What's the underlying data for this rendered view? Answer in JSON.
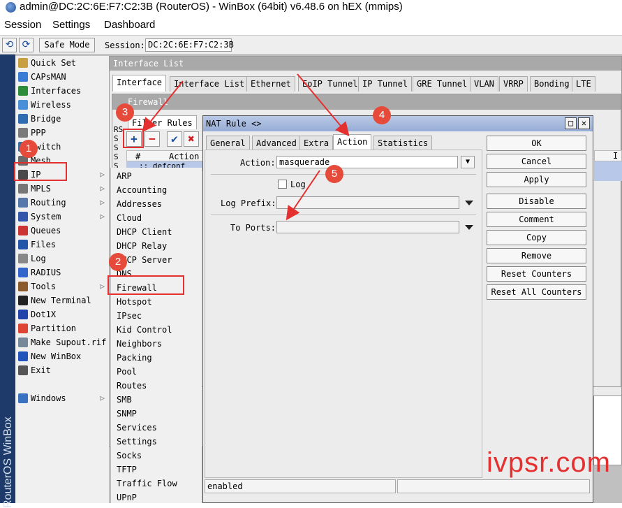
{
  "window": {
    "title": "admin@DC:2C:6E:F7:C2:3B (RouterOS) - WinBox (64bit) v6.48.6 on hEX (mmips)"
  },
  "menubar": [
    "Session",
    "Settings",
    "Dashboard"
  ],
  "toolbar": {
    "safe_mode_label": "Safe Mode",
    "session_label": "Session:",
    "session_value": "DC:2C:6E:F7:C2:3B"
  },
  "vertical_brand": "RouterOS WinBox",
  "sidebar": {
    "items": [
      {
        "label": "Quick Set",
        "icon": "quick-set-icon"
      },
      {
        "label": "CAPsMAN",
        "icon": "capsman-icon"
      },
      {
        "label": "Interfaces",
        "icon": "interfaces-icon"
      },
      {
        "label": "Wireless",
        "icon": "wireless-icon"
      },
      {
        "label": "Bridge",
        "icon": "bridge-icon"
      },
      {
        "label": "PPP",
        "icon": "ppp-icon"
      },
      {
        "label": "Switch",
        "icon": "switch-icon"
      },
      {
        "label": "Mesh",
        "icon": "mesh-icon"
      },
      {
        "label": "IP",
        "icon": "ip-icon",
        "submenu": true
      },
      {
        "label": "MPLS",
        "icon": "mpls-icon",
        "submenu": true
      },
      {
        "label": "Routing",
        "icon": "routing-icon",
        "submenu": true
      },
      {
        "label": "System",
        "icon": "system-icon",
        "submenu": true
      },
      {
        "label": "Queues",
        "icon": "queues-icon"
      },
      {
        "label": "Files",
        "icon": "files-icon"
      },
      {
        "label": "Log",
        "icon": "log-icon"
      },
      {
        "label": "RADIUS",
        "icon": "radius-icon"
      },
      {
        "label": "Tools",
        "icon": "tools-icon",
        "submenu": true
      },
      {
        "label": "New Terminal",
        "icon": "terminal-icon"
      },
      {
        "label": "Dot1X",
        "icon": "dot1x-icon"
      },
      {
        "label": "Partition",
        "icon": "partition-icon"
      },
      {
        "label": "Make Supout.rif",
        "icon": "supout-icon"
      },
      {
        "label": "New WinBox",
        "icon": "winbox-icon"
      },
      {
        "label": "Exit",
        "icon": "exit-icon"
      },
      {
        "label": "Windows",
        "icon": "windows-icon",
        "submenu": true
      }
    ],
    "submenu_arrow": "▷"
  },
  "ip_submenu": [
    "ARP",
    "Accounting",
    "Addresses",
    "Cloud",
    "DHCP Client",
    "DHCP Relay",
    "DHCP Server",
    "DNS",
    "Firewall",
    "Hotspot",
    "IPsec",
    "Kid Control",
    "Neighbors",
    "Packing",
    "Pool",
    "Routes",
    "SMB",
    "SNMP",
    "Services",
    "Settings",
    "Socks",
    "TFTP",
    "Traffic Flow",
    "UPnP"
  ],
  "interface_list": {
    "title": "Interface List",
    "tabs": [
      "Interface",
      "Interface List",
      "Ethernet",
      "EoIP Tunnel",
      "IP Tunnel",
      "GRE Tunnel",
      "VLAN",
      "VRRP",
      "Bonding",
      "LTE"
    ]
  },
  "firewall": {
    "title": "Firewall",
    "tab": "Filter Rules",
    "col_hash": "#",
    "col_action": "Action",
    "row_text": ":: defconf",
    "status_letters": [
      "RS",
      "S",
      "S",
      "S",
      "S"
    ],
    "right_col": "I"
  },
  "nat_rule": {
    "title": "NAT Rule <>",
    "tabs": [
      "General",
      "Advanced",
      "Extra",
      "Action",
      "Statistics"
    ],
    "action_label": "Action:",
    "action_value": "masquerade",
    "log_label": "Log",
    "log_prefix_label": "Log Prefix:",
    "to_ports_label": "To Ports:",
    "buttons": [
      "OK",
      "Cancel",
      "Apply",
      "Disable",
      "Comment",
      "Copy",
      "Remove",
      "Reset Counters",
      "Reset All Counters"
    ],
    "status": "enabled"
  },
  "annotations": [
    "1",
    "2",
    "3",
    "4",
    "5"
  ],
  "watermark": "ivpsr.com",
  "colors": {
    "annotation": "#e53030",
    "title_active": "#97add6"
  }
}
